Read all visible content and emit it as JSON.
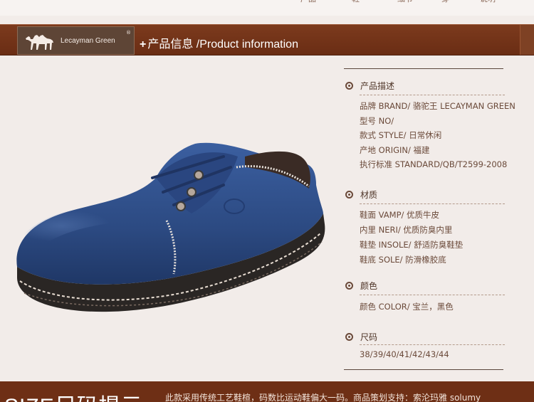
{
  "header": {
    "brand_name": "Lecayman Green",
    "registered_mark": "®",
    "plus": "+",
    "title": "产品信息 /Product information"
  },
  "top_tabs": [
    "产品",
    "鞋",
    "细节",
    "穿",
    "说明"
  ],
  "sections": [
    {
      "heading": "产品描述",
      "lines": [
        "品牌 BRAND/ 骆驼王 LECAYMAN GREEN",
        "型号 NO/",
        "款式 STYLE/ 日常休闲",
        "产地 ORIGIN/ 福建",
        "执行标准 STANDARD/QB/T2599-2008"
      ]
    },
    {
      "heading": "材质",
      "lines": [
        "鞋面 VAMP/ 优质牛皮",
        "内里 NERI/ 优质防臭内里",
        "鞋垫 INSOLE/ 舒适防臭鞋垫",
        "鞋底 SOLE/ 防滑橡胶底"
      ]
    },
    {
      "heading": "颜色",
      "lines": [
        "颜色 COLOR/ 宝兰，黑色"
      ]
    },
    {
      "heading": "尺码",
      "lines": [
        "38/39/40/41/42/43/44"
      ]
    }
  ],
  "footer": {
    "big_title": "SIZE尺码提示",
    "note": "此款采用传统工艺鞋楦，码数比运动鞋偏大一码。商品策划支持：索沦玛雅 solumy"
  },
  "colors": {
    "header_bar": "#6e2f15",
    "shoe_leather": "#2f4f8a",
    "sole": "#2a2624",
    "text": "#6b4a3a"
  }
}
